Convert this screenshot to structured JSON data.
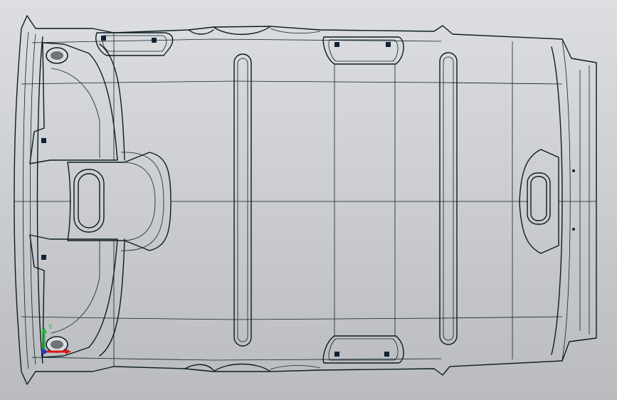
{
  "colors": {
    "background_top": "#dcdee2",
    "background_bottom": "#b9bbbf",
    "part_fill": "#22eaea",
    "part_highlight": "#8ff8f8",
    "edge_line": "#0b1b1f",
    "axis_x": "#e01818",
    "axis_y": "#18b83a",
    "axis_z": "#2040d0"
  },
  "model": {
    "name": "",
    "view": "top"
  },
  "triad": {
    "y_label": "Y",
    "x_label": "",
    "z_label": ""
  }
}
